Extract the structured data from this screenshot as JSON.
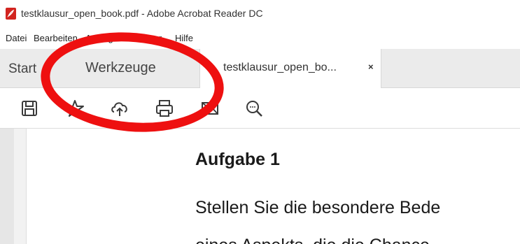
{
  "window": {
    "title": "testklausur_open_book.pdf - Adobe Acrobat Reader DC",
    "icon": "acrobat-pdf-icon"
  },
  "menu": {
    "items": [
      "Datei",
      "Bearbeiten",
      "Anzeige",
      "Fenster",
      "Hilfe"
    ]
  },
  "tabs": {
    "start": "Start",
    "tools": "Werkzeuge",
    "document": "testklausur_open_bo...",
    "close_glyph": "×"
  },
  "toolbar": {
    "icons": [
      "save-icon",
      "bookmark-star-icon",
      "cloud-upload-icon",
      "print-icon",
      "email-icon",
      "zoom-search-icon"
    ]
  },
  "document": {
    "heading": "Aufgabe 1",
    "paragraph_line_1": "Stellen Sie die besondere Bede",
    "paragraph_line_2": "eines Aspekts, die die Chance"
  },
  "annotation": {
    "color": "#ee1010",
    "shape": "ellipse"
  }
}
